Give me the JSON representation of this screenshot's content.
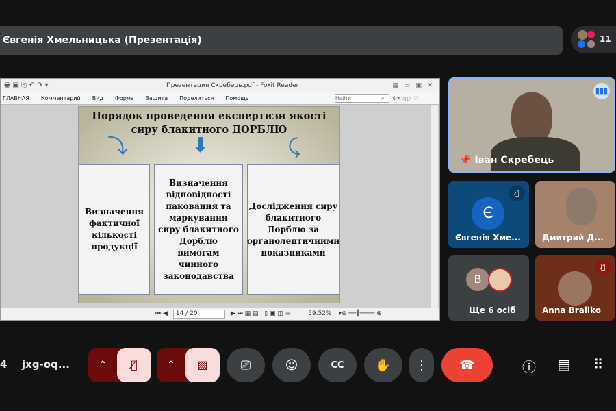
{
  "meeting": {
    "presenter_title": "Євгенія Хмельницька (Презентація)",
    "participant_count": "11",
    "time_fragment": "4",
    "code": "jxg-oq..."
  },
  "foxit": {
    "title": "Презентация Скребець.pdf - Foxit Reader",
    "menu": [
      "ГЛАВНАЯ",
      "Комментарий",
      "Вид",
      "Форма",
      "Защита",
      "Поделиться",
      "Помощь"
    ],
    "search_placeholder": "Найти",
    "page": "14 / 20",
    "zoom": "59.52%"
  },
  "slide": {
    "title": "Порядок проведення експертизи якості сиру блакитного ДОРБЛЮ",
    "boxes": [
      "Визначення фактичної кількості продукції",
      "Визначення відповідності паковання та маркування сиру блакитного Дорблю вимогам чинного законодавства",
      "Дослідження сиру блакитного Дорблю за органолептичними показниками"
    ]
  },
  "tiles": {
    "main": "Іван Скребець",
    "t1": "Євгенія Хме...",
    "t1_initial": "Є",
    "t2": "Дмитрий Д...",
    "t3": "Ще 6 осіб",
    "t3_initial": "В",
    "t4": "Anna Brailko"
  },
  "colors": {
    "accent": "#8ab4f8",
    "hangup": "#ea4335",
    "muted_bg": "#fadcdc"
  }
}
